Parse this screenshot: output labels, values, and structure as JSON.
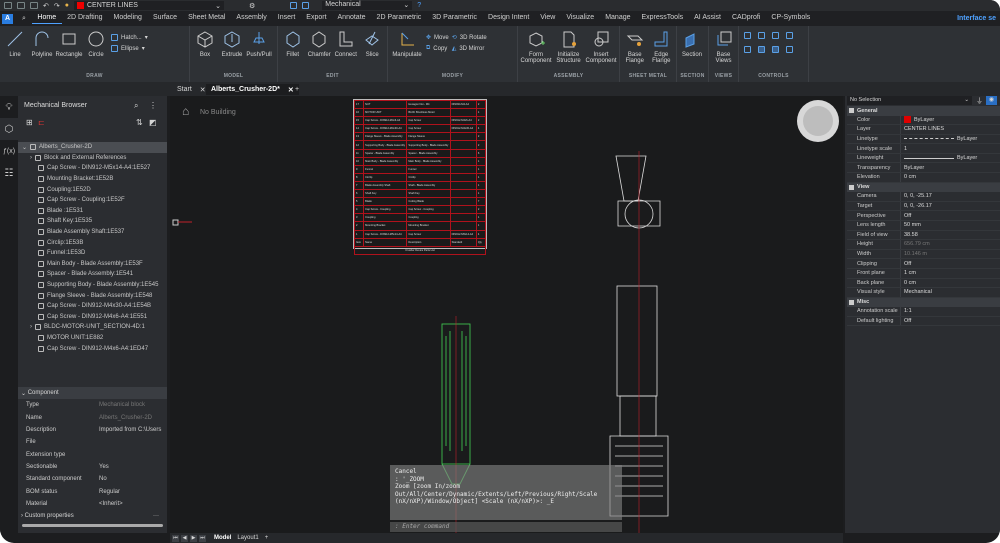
{
  "quickbar": {
    "layer": "CENTER LINES",
    "workspace": "Mechanical",
    "layer_color": "#e00000"
  },
  "tabs": [
    "Home",
    "2D Drafting",
    "Modeling",
    "Surface",
    "Sheet Metal",
    "Assembly",
    "Insert",
    "Export",
    "Annotate",
    "2D Parametric",
    "3D Parametric",
    "Design Intent",
    "View",
    "Visualize",
    "Manage",
    "ExpressTools",
    "AI Assist",
    "CADprofi",
    "CP-Symbols"
  ],
  "interface_label": "Interface se",
  "ribbon": {
    "draw": {
      "label": "DRAW",
      "tools": [
        "Line",
        "Polyline",
        "Rectangle",
        "Circle"
      ],
      "small": [
        "Hatch...",
        "Ellipse"
      ]
    },
    "model": {
      "label": "MODEL",
      "tools": [
        "Box",
        "Extrude",
        "Push/Pull"
      ]
    },
    "edit": {
      "label": "EDIT",
      "tools": [
        "Fillet",
        "Chamfer",
        "Connect",
        "Slice"
      ]
    },
    "modify": {
      "label": "MODIFY",
      "tools": [
        "Manipulate"
      ],
      "small": [
        "Move",
        "Copy",
        "3D Rotate",
        "3D Mirror"
      ]
    },
    "assembly": {
      "label": "ASSEMBLY",
      "tools": [
        "Form Component",
        "Initialize Structure",
        "Insert Component"
      ]
    },
    "sheetmetal": {
      "label": "SHEET METAL",
      "tools": [
        "Base Flange",
        "Edge Flange"
      ]
    },
    "section": {
      "label": "SECTION",
      "tools": [
        "Section"
      ]
    },
    "views": {
      "label": "VIEWS",
      "tools": [
        "Base Views"
      ]
    },
    "controls": {
      "label": "CONTROLS"
    }
  },
  "doc_tabs": {
    "start": "Start",
    "active": "Alberts_Crusher-2D*"
  },
  "browser": {
    "title": "Mechanical Browser",
    "root": "Alberts_Crusher-2D",
    "items": [
      "Block and External References",
      "Cap Screw - DIN912-M5x14-A4:1E527",
      "Mounting Bracket:1E52B",
      "Coupling:1E52D",
      "Cap Screw - Coupling:1E52F",
      "Blade :1E531",
      "Shaft Key:1E535",
      "Blade Assembly Shaft:1E537",
      "Circlip:1E53B",
      "Funnel:1E53D",
      "Main Body - Blade Assembly:1E53F",
      "Spacer - Blade Assembly:1E541",
      "Supporting Body - Blade Assembly:1E545",
      "Flange Sleeve - Blade Assembly:1E548",
      "Cap Screw - DIN912-M4x30-A4:1E54B",
      "Cap Screw - DIN912-M4x6-A4:1E551",
      "BLDC-MOTOR-UNIT_SECTION-4D:1",
      "MOTOR UNIT:1E882",
      "Cap Screw - DIN912-M4x6-A4:1ED47"
    ]
  },
  "component": {
    "title": "Component",
    "rows": [
      {
        "k": "Type",
        "v": "Mechanical block"
      },
      {
        "k": "Name",
        "v": "Alberts_Crusher-2D"
      },
      {
        "k": "Description",
        "v": "Imported from C:\\Users"
      },
      {
        "k": "File",
        "v": ""
      },
      {
        "k": "Extension type",
        "v": ""
      },
      {
        "k": "Sectionable",
        "v": "Yes"
      },
      {
        "k": "Standard component",
        "v": "No"
      },
      {
        "k": "BOM status",
        "v": "Regular"
      },
      {
        "k": "Material",
        "v": "<Inherit>"
      }
    ],
    "custom": "Custom properties"
  },
  "canvas": {
    "building": "No Building"
  },
  "bom": {
    "rows": [
      [
        "17",
        "NUT",
        "Hexagon Nut - M4",
        "DIN934-M4-A4",
        "2"
      ],
      [
        "16",
        "MOTOR UNIT",
        "BLDC Brushless Motor",
        "",
        "1"
      ],
      [
        "15",
        "Cap Screw - DIN912-M4x6-A4",
        "Cap Screw",
        "DIN912-M4x6-A4",
        "2"
      ],
      [
        "14",
        "Cap Screw - DIN912-M4x30-A4",
        "Cap Screw",
        "DIN912-M4x30-A4",
        "4"
      ],
      [
        "13",
        "Flange Sleeve - Blade Assembly",
        "Flange Sleeve",
        "",
        "2"
      ],
      [
        "12",
        "Supporting Body - Blade Assembly",
        "Supporting Body - Blade Assembly",
        "",
        "2"
      ],
      [
        "11",
        "Spacer - Blade Assembly",
        "Spacer - Blade Assembly",
        "",
        "6"
      ],
      [
        "10",
        "Main Body - Blade Assembly",
        "Main Body - Blade Assembly",
        "",
        "1"
      ],
      [
        "9",
        "Funnel",
        "Funnel",
        "",
        "1"
      ],
      [
        "8",
        "Circlip",
        "Circlip",
        "",
        "1"
      ],
      [
        "7",
        "Blade Assembly Shaft",
        "Shaft - Blade Assembly",
        "",
        "1"
      ],
      [
        "6",
        "Shaft Key",
        "Shaft Key",
        "",
        "1"
      ],
      [
        "5",
        "Blade",
        "Cutting Blade",
        "",
        "7"
      ],
      [
        "4",
        "Cap Screw - Coupling",
        "Cap Screw - Coupling",
        "",
        "2"
      ],
      [
        "3",
        "Coupling",
        "Coupling",
        "",
        "1"
      ],
      [
        "2",
        "Mounting Bracket",
        "Mounting Bracket",
        "",
        "1"
      ],
      [
        "1",
        "Cap Screw - DIN912-M5x14-A4",
        "Cap Screw",
        "DIN912-M5x14-A4",
        "4"
      ]
    ],
    "header": [
      "Item",
      "Name",
      "Description",
      "Standard",
      "Qty"
    ],
    "caption": "Crusher Device Parts List"
  },
  "command": {
    "lines": [
      "Cancel",
      ": '_ZOOM",
      "Zoom [zoom In/zoom",
      "Out/All/Center/Dynamic/Extents/Left/Previous/Right/Scale",
      "(nX/nXP)/Window/Object] <Scale (nX/nXP)>: _E"
    ],
    "prompt": ": Enter command"
  },
  "layout_tabs": [
    "Model",
    "Layout1"
  ],
  "properties": {
    "selection": "No Selection",
    "sections": [
      {
        "title": "General",
        "rows": [
          {
            "k": "Color",
            "v": "ByLayer",
            "swatch": "#e00000"
          },
          {
            "k": "Layer",
            "v": "CENTER LINES"
          },
          {
            "k": "Linetype",
            "v": "ByLayer"
          },
          {
            "k": "Linetype scale",
            "v": "1"
          },
          {
            "k": "Lineweight",
            "v": "ByLayer"
          },
          {
            "k": "Transparency",
            "v": "ByLayer"
          },
          {
            "k": "Elevation",
            "v": "0 cm"
          }
        ]
      },
      {
        "title": "View",
        "rows": [
          {
            "k": "Camera",
            "v": "0, 0, -25.17"
          },
          {
            "k": "Target",
            "v": "0, 0, -26.17"
          },
          {
            "k": "Perspective",
            "v": "Off"
          },
          {
            "k": "Lens length",
            "v": "50 mm"
          },
          {
            "k": "Field of view",
            "v": "38.58"
          },
          {
            "k": "Height",
            "v": "656.79 cm",
            "dim": true
          },
          {
            "k": "Width",
            "v": "10.146 m",
            "dim": true
          },
          {
            "k": "Clipping",
            "v": "Off"
          },
          {
            "k": "Front plane",
            "v": "1 cm"
          },
          {
            "k": "Back plane",
            "v": "0 cm"
          },
          {
            "k": "Visual style",
            "v": "Mechanical"
          }
        ]
      },
      {
        "title": "Misc",
        "rows": [
          {
            "k": "Annotation scale",
            "v": "1:1"
          },
          {
            "k": "Default lighting",
            "v": "Off"
          }
        ]
      }
    ]
  }
}
